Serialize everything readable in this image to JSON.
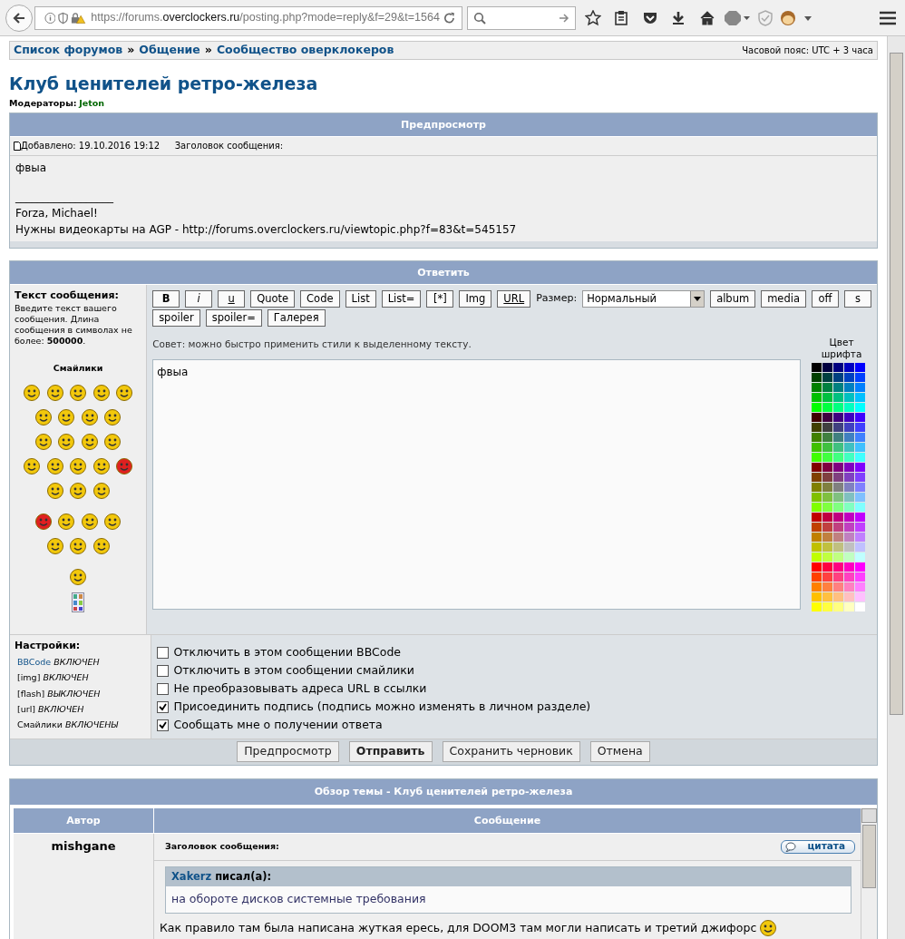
{
  "browser": {
    "url_prefix": "https://forums.",
    "url_domain": "overclockers.ru",
    "url_path": "/posting.php?mode=reply&f=29&t=1564"
  },
  "breadcrumbs": {
    "separator": "»",
    "links": [
      "Список форумов",
      "Общение",
      "Сообщество оверклокеров"
    ],
    "timezone": "Часовой пояс: UTC + 3 часа"
  },
  "forum_title": "Клуб ценителей ретро-железа",
  "moderators": {
    "label": "Модераторы:",
    "name": "Jeton"
  },
  "preview": {
    "title": "Предпросмотр",
    "added": "Добавлено: 19.10.2016 19:12",
    "subject_label": "Заголовок сообщения:",
    "text": "фвыа",
    "signature": [
      "__________________",
      "Forza, Michael!",
      "Нужны видеокарты на AGP - http://forums.overclockers.ru/viewtopic.php?f=83&t=545157"
    ]
  },
  "reply": {
    "title": "Ответить",
    "text_label": "Текст сообщения:",
    "hint": "Введите текст вашего сообщения. Длина сообщения в символах не более: **500000**.",
    "smilies_title": "Смайлики",
    "toolbar_rows": [
      {
        "items": [
          {
            "kind": "bold",
            "label": "B"
          },
          {
            "kind": "italic",
            "label": "i"
          },
          {
            "kind": "underline",
            "label": "u"
          },
          {
            "kind": "button",
            "label": "Quote"
          },
          {
            "kind": "button",
            "label": "Code"
          },
          {
            "kind": "button",
            "label": "List"
          },
          {
            "kind": "button",
            "label": "List="
          },
          {
            "kind": "button",
            "label": "[*]"
          },
          {
            "kind": "button",
            "label": "Img"
          },
          {
            "kind": "underline",
            "label": "URL"
          },
          {
            "kind": "select",
            "label": "Размер:",
            "value": "Нормальный"
          },
          {
            "kind": "button",
            "label": "album"
          },
          {
            "kind": "button",
            "label": "media"
          },
          {
            "kind": "button",
            "label": "off"
          },
          {
            "kind": "button",
            "label": "s"
          }
        ]
      },
      {
        "items": [
          {
            "kind": "button",
            "label": "spoiler"
          },
          {
            "kind": "button",
            "label": "spoiler="
          },
          {
            "kind": "button",
            "label": "Галерея"
          }
        ]
      }
    ],
    "tip": "Совет: можно быстро применить стили к выделенному тексту.",
    "message": "фвыа",
    "color_label": "Цвет шрифта",
    "palette_rows": [
      {
        "swatches": [
          {
            "color": "#000000"
          },
          {
            "color": "#000040"
          },
          {
            "color": "#000080"
          },
          {
            "color": "#0000c0"
          },
          {
            "color": "#0000ff"
          }
        ]
      },
      {
        "swatches": [
          {
            "color": "#004000"
          },
          {
            "color": "#004040"
          },
          {
            "color": "#004080"
          },
          {
            "color": "#0040c0"
          },
          {
            "color": "#0040ff"
          }
        ]
      },
      {
        "swatches": [
          {
            "color": "#008000"
          },
          {
            "color": "#008040"
          },
          {
            "color": "#008080"
          },
          {
            "color": "#0080c0"
          },
          {
            "color": "#0080ff"
          }
        ]
      },
      {
        "swatches": [
          {
            "color": "#00c000"
          },
          {
            "color": "#00c040"
          },
          {
            "color": "#00c080"
          },
          {
            "color": "#00c0c0"
          },
          {
            "color": "#00c0ff"
          }
        ]
      },
      {
        "swatches": [
          {
            "color": "#00ff00"
          },
          {
            "color": "#00ff40"
          },
          {
            "color": "#00ff80"
          },
          {
            "color": "#00ffc0"
          },
          {
            "color": "#00ffff"
          }
        ]
      },
      {
        "swatches": [
          {
            "color": "#400000"
          },
          {
            "color": "#400040"
          },
          {
            "color": "#400080"
          },
          {
            "color": "#4000c0"
          },
          {
            "color": "#4000ff"
          }
        ]
      },
      {
        "swatches": [
          {
            "color": "#404000"
          },
          {
            "color": "#404040"
          },
          {
            "color": "#404080"
          },
          {
            "color": "#4040c0"
          },
          {
            "color": "#4040ff"
          }
        ]
      },
      {
        "swatches": [
          {
            "color": "#408000"
          },
          {
            "color": "#408040"
          },
          {
            "color": "#408080"
          },
          {
            "color": "#4080c0"
          },
          {
            "color": "#4080ff"
          }
        ]
      },
      {
        "swatches": [
          {
            "color": "#40c000"
          },
          {
            "color": "#40c040"
          },
          {
            "color": "#40c080"
          },
          {
            "color": "#40c0c0"
          },
          {
            "color": "#40c0ff"
          }
        ]
      },
      {
        "swatches": [
          {
            "color": "#40ff00"
          },
          {
            "color": "#40ff40"
          },
          {
            "color": "#40ff80"
          },
          {
            "color": "#40ffc0"
          },
          {
            "color": "#40ffff"
          }
        ]
      },
      {
        "swatches": [
          {
            "color": "#800000"
          },
          {
            "color": "#800040"
          },
          {
            "color": "#800080"
          },
          {
            "color": "#8000c0"
          },
          {
            "color": "#8000ff"
          }
        ]
      },
      {
        "swatches": [
          {
            "color": "#804000"
          },
          {
            "color": "#804040"
          },
          {
            "color": "#804080"
          },
          {
            "color": "#8040c0"
          },
          {
            "color": "#8040ff"
          }
        ]
      },
      {
        "swatches": [
          {
            "color": "#808000"
          },
          {
            "color": "#808040"
          },
          {
            "color": "#808080"
          },
          {
            "color": "#8080c0"
          },
          {
            "color": "#8080ff"
          }
        ]
      },
      {
        "swatches": [
          {
            "color": "#80c000"
          },
          {
            "color": "#80c040"
          },
          {
            "color": "#80c080"
          },
          {
            "color": "#80c0c0"
          },
          {
            "color": "#80c0ff"
          }
        ]
      },
      {
        "swatches": [
          {
            "color": "#80ff00"
          },
          {
            "color": "#80ff40"
          },
          {
            "color": "#80ff80"
          },
          {
            "color": "#80ffc0"
          },
          {
            "color": "#80ffff"
          }
        ]
      },
      {
        "swatches": [
          {
            "color": "#c00000"
          },
          {
            "color": "#c00040"
          },
          {
            "color": "#c00080"
          },
          {
            "color": "#c000c0"
          },
          {
            "color": "#c000ff"
          }
        ]
      },
      {
        "swatches": [
          {
            "color": "#c04000"
          },
          {
            "color": "#c04040"
          },
          {
            "color": "#c04080"
          },
          {
            "color": "#c040c0"
          },
          {
            "color": "#c040ff"
          }
        ]
      },
      {
        "swatches": [
          {
            "color": "#c08000"
          },
          {
            "color": "#c08040"
          },
          {
            "color": "#c08080"
          },
          {
            "color": "#c080c0"
          },
          {
            "color": "#c080ff"
          }
        ]
      },
      {
        "swatches": [
          {
            "color": "#c0c000"
          },
          {
            "color": "#c0c040"
          },
          {
            "color": "#c0c080"
          },
          {
            "color": "#c0c0c0"
          },
          {
            "color": "#c0c0ff"
          }
        ]
      },
      {
        "swatches": [
          {
            "color": "#c0ff00"
          },
          {
            "color": "#c0ff40"
          },
          {
            "color": "#c0ff80"
          },
          {
            "color": "#c0ffc0"
          },
          {
            "color": "#c0ffff"
          }
        ]
      },
      {
        "swatches": [
          {
            "color": "#ff0000"
          },
          {
            "color": "#ff0040"
          },
          {
            "color": "#ff0080"
          },
          {
            "color": "#ff00c0"
          },
          {
            "color": "#ff00ff"
          }
        ]
      },
      {
        "swatches": [
          {
            "color": "#ff4000"
          },
          {
            "color": "#ff4040"
          },
          {
            "color": "#ff4080"
          },
          {
            "color": "#ff40c0"
          },
          {
            "color": "#ff40ff"
          }
        ]
      },
      {
        "swatches": [
          {
            "color": "#ff8000"
          },
          {
            "color": "#ff8040"
          },
          {
            "color": "#ff8080"
          },
          {
            "color": "#ff80c0"
          },
          {
            "color": "#ff80ff"
          }
        ]
      },
      {
        "swatches": [
          {
            "color": "#ffc000"
          },
          {
            "color": "#ffc040"
          },
          {
            "color": "#ffc080"
          },
          {
            "color": "#ffc0c0"
          },
          {
            "color": "#ffc0ff"
          }
        ]
      },
      {
        "swatches": [
          {
            "color": "#ffff00"
          },
          {
            "color": "#ffff40"
          },
          {
            "color": "#ffff80"
          },
          {
            "color": "#ffffc0"
          },
          {
            "color": "#ffffff"
          }
        ]
      }
    ],
    "settings_label": "Настройки:",
    "settings": [
      {
        "name": "BBCode",
        "value": "ВКЛЮЧЕН",
        "link": true
      },
      {
        "name": "[img]",
        "value": "ВКЛЮЧЕН",
        "link": false
      },
      {
        "name": "[flash]",
        "value": "ВЫКЛЮЧЕН",
        "link": false
      },
      {
        "name": "[url]",
        "value": "ВКЛЮЧЕН",
        "link": false
      },
      {
        "name": "Смайлики",
        "value": "ВКЛЮЧЕНЫ",
        "link": false
      }
    ],
    "options": [
      {
        "label": "Отключить в этом сообщении BBCode",
        "checked": false
      },
      {
        "label": "Отключить в этом сообщении смайлики",
        "checked": false
      },
      {
        "label": "Не преобразовывать адреса URL в ссылки",
        "checked": false
      },
      {
        "label": "Присоединить подпись (подпись можно изменять в личном разделе)",
        "checked": true
      },
      {
        "label": "Сообщать мне о получении ответа",
        "checked": true
      }
    ],
    "actions": [
      {
        "label": "Предпросмотр",
        "primary": false
      },
      {
        "label": "Отправить",
        "primary": true
      },
      {
        "label": "Сохранить черновик",
        "primary": false
      },
      {
        "label": "Отмена",
        "primary": false
      }
    ]
  },
  "review": {
    "title": "Обзор темы - Клуб ценителей ретро-железа",
    "columns": [
      "Автор",
      "Сообщение"
    ],
    "post": {
      "author": "mishgane",
      "subject_label": "Заголовок сообщения:",
      "quote_button": "цитата",
      "quote_author": "Xakerz",
      "quote_suffix": "писал(а):",
      "quote_text": "на обороте дисков системные требования",
      "body": "Как правило там была написана жуткая ересь, для DOOM3 там могли написать и третий джифорс"
    }
  }
}
